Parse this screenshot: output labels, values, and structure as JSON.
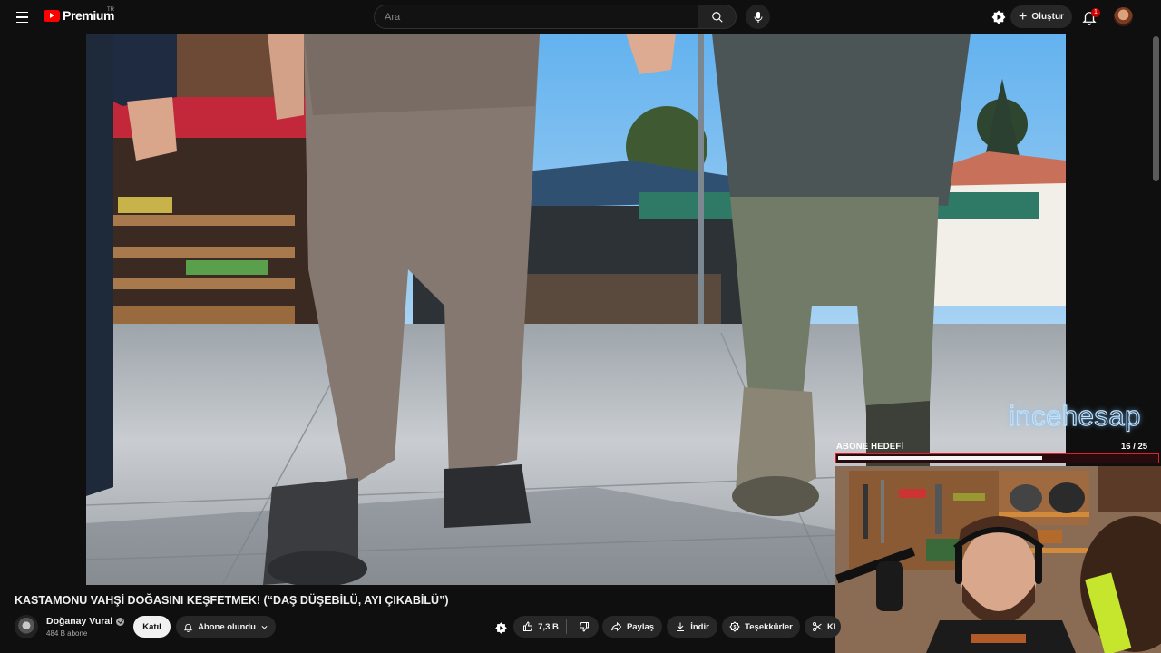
{
  "header": {
    "logo_text": "Premium",
    "country_code": "TR",
    "search_placeholder": "Ara",
    "create_label": "Oluştur",
    "notification_count": "1"
  },
  "overlay": {
    "watermark": "incehesap",
    "goal_label": "ABONE HEDEFİ",
    "goal_current": 16,
    "goal_target": 25,
    "goal_count_text": "16  / 25"
  },
  "video": {
    "title": "KASTAMONU VAHŞİ DOĞASINI KEŞFETMEK! (“DAŞ DÜŞEBİLÜ, AYI ÇIKABİLÜ”)"
  },
  "channel": {
    "name": "Doğanay Vural",
    "subscribers": "484 B abone",
    "join_label": "Katıl",
    "subscribed_label": "Abone olundu"
  },
  "actions": {
    "likes": "7,3 B",
    "share_label": "Paylaş",
    "download_label": "İndir",
    "thanks_label": "Teşekkürler",
    "clip_label": "Kl"
  },
  "colors": {
    "background": "#0f0f0f",
    "brand_red": "#ff0000",
    "goal_border": "#e0202b",
    "chip_bg": "#272727"
  }
}
